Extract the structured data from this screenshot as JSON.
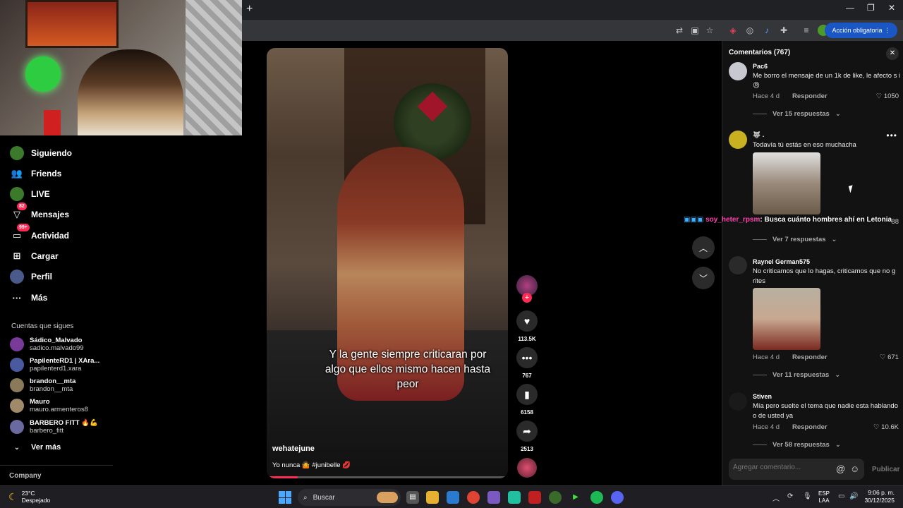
{
  "browser": {
    "new_tab": "+",
    "win_min": "—",
    "win_max": "❐",
    "win_close": "✕",
    "required_action": "Acción obligatoria"
  },
  "nav": {
    "items": [
      {
        "label": "Siguiendo",
        "icon": "following-icon"
      },
      {
        "label": "Friends",
        "icon": "friends-icon"
      },
      {
        "label": "LIVE",
        "icon": "live-icon"
      },
      {
        "label": "Mensajes",
        "icon": "messages-icon",
        "badge": "82"
      },
      {
        "label": "Actividad",
        "icon": "activity-icon",
        "badge": "99+"
      },
      {
        "label": "Cargar",
        "icon": "upload-icon"
      },
      {
        "label": "Perfil",
        "icon": "profile-icon"
      },
      {
        "label": "Más",
        "icon": "more-icon"
      }
    ],
    "following_title": "Cuentas que sigues",
    "following": [
      {
        "name": "Sádico_Malvado",
        "user": "sadico.malvado99"
      },
      {
        "name": "PapilenteRD1 | XAra...",
        "user": "papilenterd1.xara"
      },
      {
        "name": "brandon__mta",
        "user": "brandon__mta"
      },
      {
        "name": "Mauro",
        "user": "mauro.armenteros8"
      },
      {
        "name": "BARBERO FITT 🔥💪",
        "user": "barbero_fitt"
      }
    ],
    "see_more": "Ver más",
    "company": "Company"
  },
  "video": {
    "caption": "Y la gente siempre criticaran por algo que ellos mismo hacen hasta peor",
    "author": "wehatejune",
    "description": "Yo nunca 🤷 #junibelle 💋",
    "progress": 0.13
  },
  "rail": {
    "likes": "113.5K",
    "comments": "767",
    "saves": "6158",
    "shares": "2513"
  },
  "comments": {
    "title": "Comentarios (767)",
    "list": [
      {
        "user": "Pac6",
        "text": "Me borro el mensaje de un 1k de like, le afecto s i😠",
        "time": "Hace 4 d",
        "reply": "Responder",
        "likes": "1050",
        "replies": "Ver 15 respuestas"
      },
      {
        "user": "🐺 .",
        "text": "Todavía tú estás en eso muchacha",
        "time": "",
        "reply": "",
        "likes": "88",
        "replies": "Ver 7 respuestas"
      },
      {
        "user": "Raynel German575",
        "text": "No criticamos que lo hagas, criticamos que no g rites",
        "time": "Hace 4 d",
        "reply": "Responder",
        "likes": "671",
        "replies": "Ver 11 respuestas"
      },
      {
        "user": "Stiven",
        "text": "Mía pero suelte el tema que nadie esta hablando o de usted ya",
        "time": "Hace 4 d",
        "reply": "Responder",
        "likes": "10.6K",
        "replies": "Ver 58 respuestas"
      }
    ],
    "chat_user": "soy_heter_rpsm",
    "chat_msg": ": Busca cuánto hombres ahí en Letonia",
    "input_placeholder": "Agregar comentario...",
    "publish": "Publicar"
  },
  "taskbar": {
    "temp": "23°C",
    "weather": "Despejado",
    "search": "Buscar",
    "lang1": "ESP",
    "lang2": "LAA",
    "time": "9:06 p. m.",
    "date": "30/12/2025"
  }
}
